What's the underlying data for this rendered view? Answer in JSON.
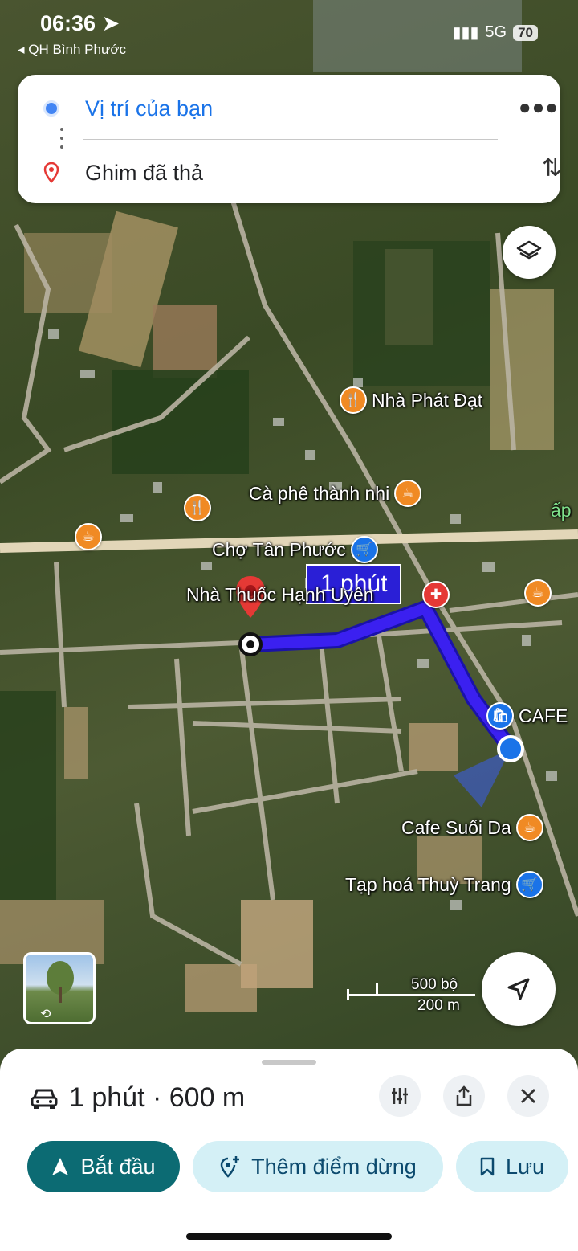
{
  "status_bar": {
    "time": "06:36",
    "back_app": "◂ QH Bình Phước",
    "network": "5G",
    "battery": "70"
  },
  "directions": {
    "origin": "Vị trí của bạn",
    "destination": "Ghim đã thả"
  },
  "map": {
    "route_label": "1 phút",
    "pois": [
      {
        "label": "Nhà Phát Đạt",
        "icon": "restaurant-icon"
      },
      {
        "label": "Cà phê thành nhi",
        "icon": "coffee-icon"
      },
      {
        "label": "Chợ Tân Phước",
        "icon": "shopping-cart-icon"
      },
      {
        "label": "Nhà Thuốc Hạnh Uyên",
        "icon": "pharmacy-icon"
      },
      {
        "label": "CAFE",
        "icon": "shopping-bag-icon"
      },
      {
        "label": "Cafe Suối Da",
        "icon": "coffee-icon"
      },
      {
        "label": "Tạp hoá Thuỳ Trang",
        "icon": "shopping-cart-icon"
      }
    ],
    "edge_text": "ấp",
    "scale": {
      "imperial": "500 bộ",
      "metric": "200 m"
    }
  },
  "sheet": {
    "summary": "1 phút · 600 m",
    "buttons": {
      "start": "Bắt đầu",
      "add_stop": "Thêm điểm dừng",
      "save": "Lưu"
    }
  },
  "colors": {
    "route": "#3b20f0",
    "start_button": "#0c6b73",
    "pill_bg": "#d4f0f6",
    "origin_blue": "#4285f4",
    "pin_red": "#e53935"
  }
}
